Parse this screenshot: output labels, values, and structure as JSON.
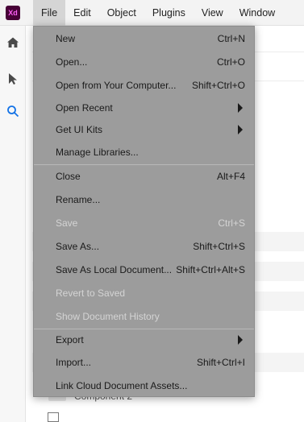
{
  "app": {
    "logo_text": "Xd",
    "logo_color": "#470137",
    "logo_text_color": "#ff61f6"
  },
  "menubar": {
    "items": [
      {
        "label": "File",
        "active": true
      },
      {
        "label": "Edit"
      },
      {
        "label": "Object"
      },
      {
        "label": "Plugins"
      },
      {
        "label": "View"
      },
      {
        "label": "Window"
      }
    ]
  },
  "toolbar": {
    "tools": [
      {
        "icon": "home-icon"
      },
      {
        "icon": "select-arrow-icon"
      },
      {
        "icon": "search-icon"
      }
    ]
  },
  "background": {
    "component_label": "Component 2"
  },
  "file_menu": {
    "items": [
      {
        "label": "New",
        "shortcut": "Ctrl+N"
      },
      {
        "label": "Open...",
        "shortcut": "Ctrl+O"
      },
      {
        "label": "Open from Your Computer...",
        "shortcut": "Shift+Ctrl+O"
      },
      {
        "label": "Open Recent",
        "submenu": true
      },
      {
        "label": "Get UI Kits",
        "submenu": true
      },
      {
        "label": "Manage Libraries..."
      },
      {
        "label": "Close",
        "shortcut": "Alt+F4"
      },
      {
        "label": "Rename..."
      },
      {
        "label": "Save",
        "shortcut": "Ctrl+S",
        "disabled": true
      },
      {
        "label": "Save As...",
        "shortcut": "Shift+Ctrl+S"
      },
      {
        "label": "Save As Local Document...",
        "shortcut": "Shift+Ctrl+Alt+S"
      },
      {
        "label": "Revert to Saved",
        "disabled": true
      },
      {
        "label": "Show Document History",
        "disabled": true
      },
      {
        "label": "Export",
        "submenu": true
      },
      {
        "label": "Import...",
        "shortcut": "Shift+Ctrl+I"
      },
      {
        "label": "Link Cloud Document Assets..."
      }
    ]
  }
}
